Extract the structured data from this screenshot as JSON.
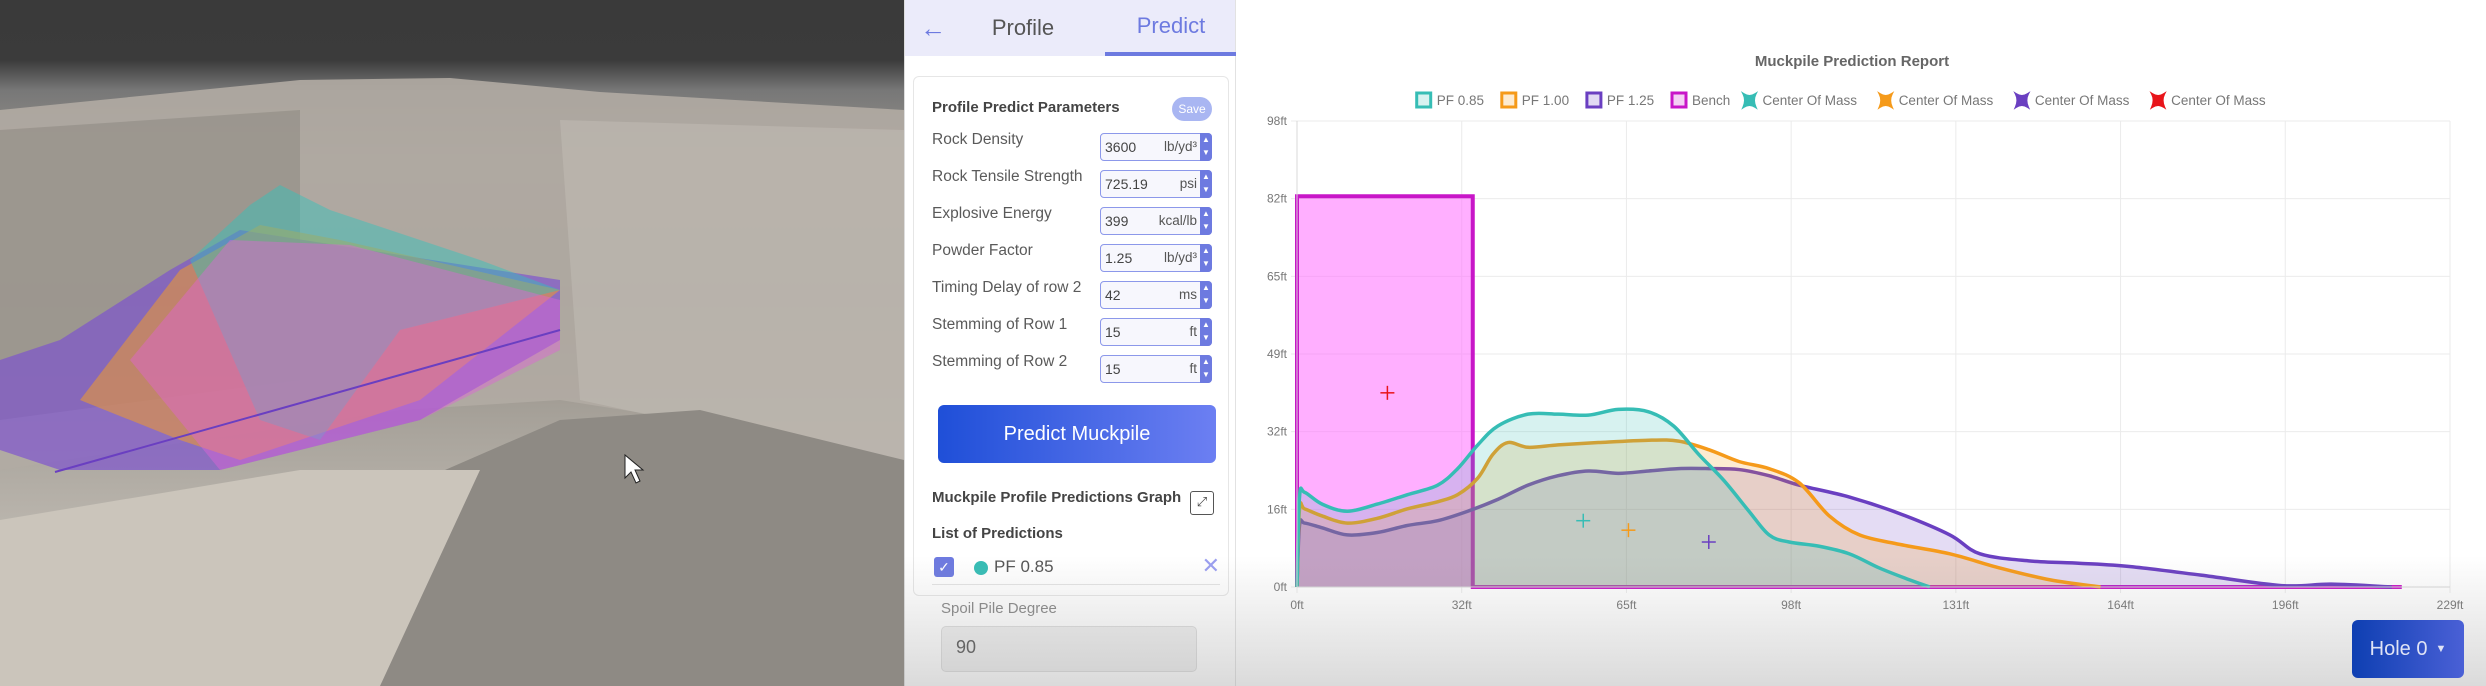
{
  "viewport": {
    "scene": "quarry bench 3D model with muckpile prediction overlays",
    "overlay_colors": [
      "#36bdb5",
      "#f59a1a",
      "#6a3fc1",
      "#e05ee0"
    ]
  },
  "panel": {
    "back_icon": "arrow-left-icon",
    "tabs": [
      {
        "label": "Profile",
        "active": false
      },
      {
        "label": "Predict",
        "active": true
      }
    ],
    "params_title": "Profile Predict Parameters",
    "save_label": "Save",
    "params": [
      {
        "label": "Rock Density",
        "value": "3600",
        "unit": "lb/yd³"
      },
      {
        "label": "Rock Tensile Strength",
        "value": "725.19",
        "unit": "psi"
      },
      {
        "label": "Explosive Energy",
        "value": "399",
        "unit": "kcal/lb"
      },
      {
        "label": "Powder Factor",
        "value": "1.25",
        "unit": "lb/yd³"
      },
      {
        "label": "Timing Delay of row 2",
        "value": "42",
        "unit": "ms"
      },
      {
        "label": "Stemming of Row 1",
        "value": "15",
        "unit": "ft"
      },
      {
        "label": "Stemming of Row 2",
        "value": "15",
        "unit": "ft"
      }
    ],
    "predict_button": "Predict Muckpile",
    "graph_label": "Muckpile Profile Predictions Graph",
    "list_label": "List of Predictions",
    "predictions": [
      {
        "name": "PF 0.85",
        "checked": true,
        "color": "#36bdb5"
      }
    ],
    "spoil_label": "Spoil Pile Degree",
    "spoil_value": "90"
  },
  "hole_selector": {
    "label": "Hole 0"
  },
  "chart_data": {
    "type": "area",
    "title": "Muckpile Prediction Report",
    "xlabel": "",
    "ylabel": "",
    "x_ticks": [
      "0ft",
      "32ft",
      "65ft",
      "98ft",
      "131ft",
      "164ft",
      "196ft",
      "229ft"
    ],
    "y_ticks": [
      "0ft",
      "16ft",
      "32ft",
      "49ft",
      "65ft",
      "82ft",
      "98ft"
    ],
    "xlim": [
      0,
      229.6
    ],
    "ylim": [
      0,
      98.4
    ],
    "grid": true,
    "legend_position": "top",
    "legend": [
      {
        "label": "PF 0.85",
        "color": "#36bdb5",
        "marker": "box"
      },
      {
        "label": "PF 1.00",
        "color": "#f59a1a",
        "marker": "box"
      },
      {
        "label": "PF 1.25",
        "color": "#6a3fc1",
        "marker": "box"
      },
      {
        "label": "Bench",
        "color": "#c816c8",
        "marker": "box"
      },
      {
        "label": "Center Of Mass",
        "color": "#36bdb5",
        "marker": "cross"
      },
      {
        "label": "Center Of Mass",
        "color": "#f59a1a",
        "marker": "cross"
      },
      {
        "label": "Center Of Mass",
        "color": "#6a3fc1",
        "marker": "cross"
      },
      {
        "label": "Center Of Mass",
        "color": "#e8141a",
        "marker": "cross"
      }
    ],
    "series": [
      {
        "name": "PF 0.85",
        "color": "#36bdb5",
        "fill": "rgba(54,189,181,0.2)",
        "points": [
          [
            0,
            0
          ],
          [
            0.5,
            19
          ],
          [
            1.5,
            20
          ],
          [
            5,
            17.5
          ],
          [
            10,
            16
          ],
          [
            16,
            17.5
          ],
          [
            22,
            19.5
          ],
          [
            28,
            21.5
          ],
          [
            32,
            25
          ],
          [
            36,
            30
          ],
          [
            40,
            34
          ],
          [
            46,
            36.5
          ],
          [
            52,
            36.5
          ],
          [
            58,
            36.3
          ],
          [
            64,
            37.5
          ],
          [
            70,
            37
          ],
          [
            75,
            34
          ],
          [
            80,
            28
          ],
          [
            85,
            22.5
          ],
          [
            90,
            16
          ],
          [
            94,
            11
          ],
          [
            98,
            9.5
          ],
          [
            104,
            8.6
          ],
          [
            110,
            7
          ],
          [
            116,
            4
          ],
          [
            122,
            1.5
          ],
          [
            126,
            0
          ]
        ]
      },
      {
        "name": "PF 1.00",
        "color": "#f59a1a",
        "fill": "rgba(245,154,26,0.2)",
        "points": [
          [
            0,
            0
          ],
          [
            0.5,
            16.5
          ],
          [
            1.5,
            16.5
          ],
          [
            5,
            15
          ],
          [
            10,
            13.5
          ],
          [
            16,
            14.5
          ],
          [
            22,
            16.5
          ],
          [
            28,
            18
          ],
          [
            32,
            19.5
          ],
          [
            36,
            23
          ],
          [
            39,
            28
          ],
          [
            42,
            30.5
          ],
          [
            46,
            29.5
          ],
          [
            52,
            30
          ],
          [
            60,
            30.5
          ],
          [
            70,
            31
          ],
          [
            76,
            30.8
          ],
          [
            82,
            29
          ],
          [
            88,
            26.5
          ],
          [
            94,
            25
          ],
          [
            100,
            22
          ],
          [
            106,
            15
          ],
          [
            112,
            11
          ],
          [
            120,
            9
          ],
          [
            130,
            7
          ],
          [
            140,
            4
          ],
          [
            150,
            1.5
          ],
          [
            160,
            0
          ]
        ]
      },
      {
        "name": "PF 1.25",
        "color": "#6a3fc1",
        "fill": "rgba(106,63,193,0.18)",
        "points": [
          [
            0,
            0
          ],
          [
            0.5,
            13
          ],
          [
            1.5,
            13.5
          ],
          [
            5,
            12.5
          ],
          [
            10,
            11
          ],
          [
            16,
            11.5
          ],
          [
            22,
            13
          ],
          [
            28,
            14
          ],
          [
            34,
            16
          ],
          [
            40,
            18.5
          ],
          [
            46,
            21.5
          ],
          [
            52,
            23.5
          ],
          [
            58,
            24.5
          ],
          [
            64,
            24
          ],
          [
            70,
            24.5
          ],
          [
            76,
            25
          ],
          [
            82,
            25
          ],
          [
            88,
            24.8
          ],
          [
            94,
            23.5
          ],
          [
            100,
            21.5
          ],
          [
            110,
            19
          ],
          [
            120,
            15.5
          ],
          [
            130,
            11
          ],
          [
            136,
            7
          ],
          [
            146,
            5.5
          ],
          [
            156,
            5
          ],
          [
            166,
            4.3
          ],
          [
            180,
            2.5
          ],
          [
            196,
            0.3
          ],
          [
            206,
            0.6
          ],
          [
            218,
            0
          ]
        ]
      },
      {
        "name": "Bench",
        "color": "#c816c8",
        "fill": "rgba(255,110,255,0.55)",
        "points": [
          [
            0,
            0
          ],
          [
            0,
            82.5
          ],
          [
            35,
            82.5
          ],
          [
            35,
            0
          ],
          [
            220,
            0
          ]
        ]
      }
    ],
    "centers_of_mass": [
      {
        "series": "PF 0.85",
        "x": 57,
        "y": 14,
        "color": "#36bdb5"
      },
      {
        "series": "PF 1.00",
        "x": 66,
        "y": 12,
        "color": "#f59a1a"
      },
      {
        "series": "PF 1.25",
        "x": 82,
        "y": 9.5,
        "color": "#6a3fc1"
      },
      {
        "series": "Bench",
        "x": 18,
        "y": 41,
        "color": "#e8141a"
      }
    ]
  }
}
